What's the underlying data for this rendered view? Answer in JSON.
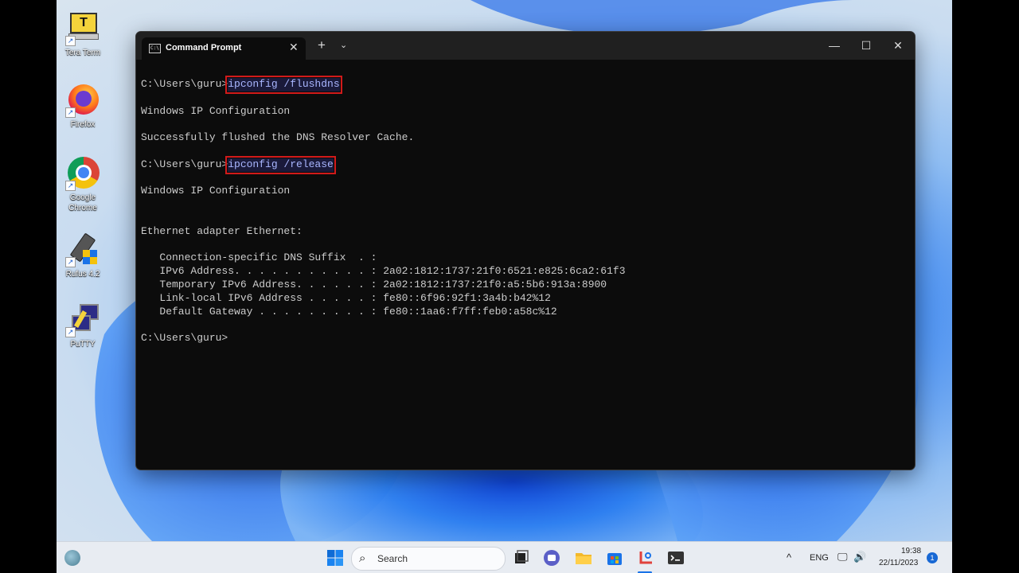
{
  "desktop": {
    "icons": [
      {
        "label": "Tera Term"
      },
      {
        "label": "Firefox"
      },
      {
        "label": "Google Chrome"
      },
      {
        "label": "Rufus 4.2"
      },
      {
        "label": "PuTTY"
      }
    ]
  },
  "window": {
    "tab_title": "Command Prompt",
    "tab_icon_text": "C:\\",
    "close_glyph": "✕",
    "new_tab_glyph": "+",
    "dropdown_glyph": "⌄",
    "min_glyph": "—",
    "max_glyph": "☐",
    "win_close_glyph": "✕"
  },
  "console": {
    "lines": [
      {
        "prompt": "C:\\Users\\guru>",
        "cmd": "ipconfig /flushdns",
        "highlight": true
      },
      {
        "text": ""
      },
      {
        "text": "Windows IP Configuration"
      },
      {
        "text": ""
      },
      {
        "text": "Successfully flushed the DNS Resolver Cache."
      },
      {
        "text": ""
      },
      {
        "prompt": "C:\\Users\\guru>",
        "cmd": "ipconfig /release",
        "highlight": true
      },
      {
        "text": ""
      },
      {
        "text": "Windows IP Configuration"
      },
      {
        "text": ""
      },
      {
        "text": ""
      },
      {
        "text": "Ethernet adapter Ethernet:"
      },
      {
        "text": ""
      },
      {
        "text": "   Connection-specific DNS Suffix  . :"
      },
      {
        "text": "   IPv6 Address. . . . . . . . . . . : 2a02:1812:1737:21f0:6521:e825:6ca2:61f3"
      },
      {
        "text": "   Temporary IPv6 Address. . . . . . : 2a02:1812:1737:21f0:a5:5b6:913a:8900"
      },
      {
        "text": "   Link-local IPv6 Address . . . . . : fe80::6f96:92f1:3a4b:b42%12"
      },
      {
        "text": "   Default Gateway . . . . . . . . . : fe80::1aa6:f7ff:feb0:a58c%12"
      },
      {
        "text": ""
      },
      {
        "prompt": "C:\\Users\\guru>",
        "cmd": "",
        "highlight": false
      }
    ]
  },
  "taskbar": {
    "search_placeholder": "Search",
    "search_glyph": "⌕",
    "tray_chevron": "^",
    "language": "ENG",
    "network_glyph": "🖵",
    "volume_glyph": "🔊",
    "time": "19:38",
    "date": "22/11/2023",
    "notification_count": "1"
  },
  "colors": {
    "console_bg": "#0c0c0c",
    "console_text": "#cccccc",
    "highlight_box": "#d11a1a",
    "command_text": "#a9b6ff",
    "taskbar_bg": "#e8ecf2"
  }
}
